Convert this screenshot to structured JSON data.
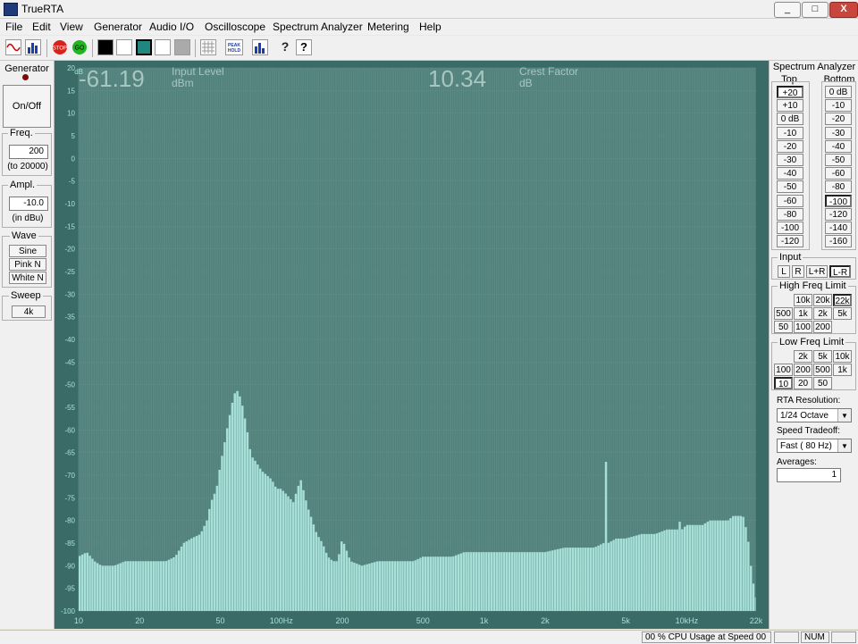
{
  "window": {
    "title": "TrueRTA",
    "btn_min": "_",
    "btn_max": "□",
    "btn_close": "X"
  },
  "menu": [
    "File",
    "Edit",
    "View",
    "Generator",
    "Audio I/O",
    "Oscilloscope",
    "Spectrum Analyzer",
    "Metering",
    "Help"
  ],
  "toolbar": {
    "stop": "STOP",
    "go": "GO",
    "peak_hold": "PEAK HOLD",
    "help": "?",
    "context_help": "?"
  },
  "generator": {
    "title": "Generator",
    "on_off": "On/Off",
    "freq_label": "Freq.",
    "freq_value": "200",
    "freq_range": "(to 20000)",
    "ampl_label": "Ampl.",
    "ampl_value": "-10.0",
    "ampl_unit": "(in dBu)",
    "wave_label": "Wave",
    "wave_options": [
      "Sine",
      "Pink N",
      "White N"
    ],
    "sweep_label": "Sweep",
    "sweep_value": "4k"
  },
  "readouts": {
    "input_level_value": "-61.19",
    "input_level_label": "Input Level",
    "input_level_unit": "dBm",
    "crest_value": "10.34",
    "crest_label": "Crest Factor",
    "crest_unit": "dB"
  },
  "spectrum_panel": {
    "title": "Spectrum Analyzer",
    "top_label": "Top",
    "bottom_label": "Bottom",
    "top_values": [
      "+20",
      "+10",
      "0 dB",
      "-10",
      "-20",
      "-30",
      "-40",
      "-50",
      "-60",
      "-80",
      "-100",
      "-120"
    ],
    "bottom_values": [
      "0 dB",
      "-10",
      "-20",
      "-30",
      "-40",
      "-50",
      "-60",
      "-80",
      "-100",
      "-120",
      "-140",
      "-160"
    ],
    "top_selected": "+20",
    "bottom_selected": "-100",
    "input_label": "Input",
    "input_options": [
      "L",
      "R",
      "L+R",
      "L-R"
    ],
    "input_selected": "L-R",
    "high_label": "High Freq Limit",
    "high_options": [
      "10k",
      "20k",
      "22k",
      "500",
      "1k",
      "2k",
      "5k",
      "50",
      "100",
      "200"
    ],
    "high_selected": "22k",
    "low_label": "Low Freq Limit",
    "low_options": [
      "2k",
      "5k",
      "10k",
      "100",
      "200",
      "500",
      "1k",
      "10",
      "20",
      "50"
    ],
    "low_selected": "10",
    "resolution_label": "RTA Resolution:",
    "resolution_value": "1/24 Octave",
    "speed_label": "Speed Tradeoff:",
    "speed_value": "Fast ( 80 Hz)",
    "averages_label": "Averages:",
    "averages_value": "1"
  },
  "status": {
    "cpu": "00 % CPU Usage at Speed 00",
    "num": "NUM"
  },
  "chart_data": {
    "type": "bar",
    "x_scale": "log",
    "xlim": [
      10,
      22000
    ],
    "ylim": [
      -100,
      20
    ],
    "y_unit": "dB",
    "y_ticks": [
      "20",
      "15",
      "10",
      "5",
      "0",
      "-5",
      "-10",
      "-15",
      "-20",
      "-25",
      "-30",
      "-35",
      "-40",
      "-45",
      "-50",
      "-55",
      "-60",
      "-65",
      "-70",
      "-75",
      "-80",
      "-85",
      "-90",
      "-95",
      "-100"
    ],
    "x_ticks": [
      "10",
      "20",
      "50",
      "100Hz",
      "200",
      "500",
      "1k",
      "2k",
      "5k",
      "10kHz",
      "22k"
    ],
    "x_tick_values": [
      10,
      20,
      50,
      100,
      200,
      500,
      1000,
      2000,
      5000,
      10000,
      22000
    ],
    "bar_color": "#a6e0d8",
    "background": "#3b6b66",
    "series": [
      {
        "x": [
          10,
          11,
          12,
          13,
          15,
          17,
          20,
          23,
          27,
          30,
          33,
          36,
          40,
          43,
          45,
          48,
          50,
          52,
          55,
          58,
          60,
          62,
          64,
          66,
          68,
          70,
          72,
          75,
          80,
          85,
          90,
          95,
          100,
          105,
          110,
          115,
          120,
          125,
          130,
          135,
          140,
          150,
          160,
          170,
          180,
          190,
          200,
          220,
          250,
          300,
          350,
          400,
          450,
          500,
          600,
          700,
          800,
          900,
          1000,
          1200,
          1500,
          2000,
          2500,
          3000,
          3500,
          3900,
          4000,
          4100,
          4500,
          5000,
          6000,
          7000,
          8000,
          9000,
          9300,
          9500,
          10000,
          11000,
          12000,
          13000,
          14000,
          15000,
          16000,
          17000,
          18000,
          19000,
          20000,
          21000,
          22000
        ],
        "y": [
          -88,
          -87,
          -89,
          -90,
          -90,
          -89,
          -89,
          -89,
          -89,
          -88,
          -85,
          -84,
          -83,
          -80,
          -76,
          -73,
          -68,
          -64,
          -58,
          -53,
          -51,
          -52,
          -54,
          -57,
          -60,
          -64,
          -66,
          -67,
          -69,
          -70,
          -71,
          -73,
          -73,
          -74,
          -75,
          -76,
          -73,
          -71,
          -74,
          -77,
          -79,
          -83,
          -85,
          -88,
          -89,
          -89,
          -84,
          -89,
          -90,
          -89,
          -89,
          -89,
          -89,
          -88,
          -88,
          -88,
          -87,
          -87,
          -87,
          -87,
          -87,
          -87,
          -86,
          -86,
          -86,
          -85,
          -66,
          -85,
          -84,
          -84,
          -83,
          -83,
          -82,
          -82,
          -80,
          -82,
          -81,
          -81,
          -81,
          -80,
          -80,
          -80,
          -80,
          -79,
          -79,
          -79,
          -83,
          -92,
          -97
        ]
      }
    ]
  }
}
